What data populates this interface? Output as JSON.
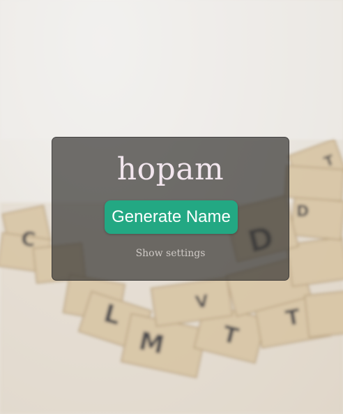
{
  "generator": {
    "name": "hopam",
    "generate_label": "Generate Name",
    "settings_label": "Show settings"
  },
  "colors": {
    "button": "#23a883",
    "name_text": "#f2e6ee",
    "panel": "rgba(60,58,55,0.72)"
  }
}
